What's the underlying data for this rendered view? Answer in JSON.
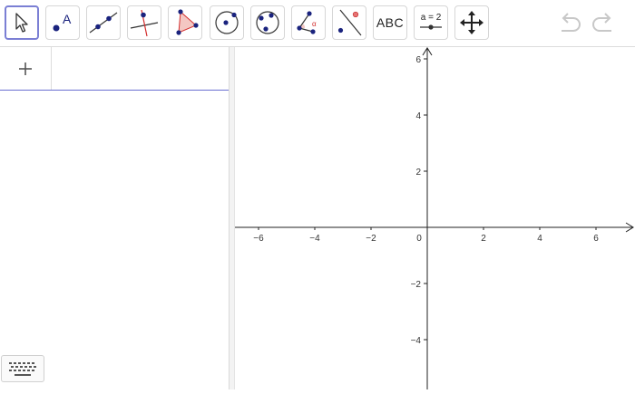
{
  "toolbar": {
    "tools": [
      {
        "name": "move-tool",
        "icon": "cursor-arrow-icon",
        "selected": true
      },
      {
        "name": "point-tool",
        "icon": "point-with-label-a-icon",
        "label": "A"
      },
      {
        "name": "line-tool",
        "icon": "line-through-two-points-icon"
      },
      {
        "name": "perpendicular-line-tool",
        "icon": "perpendicular-line-icon"
      },
      {
        "name": "polygon-tool",
        "icon": "polygon-triangle-icon"
      },
      {
        "name": "circle-tool",
        "icon": "circle-center-point-icon"
      },
      {
        "name": "circle-through-points-tool",
        "icon": "circle-three-points-icon"
      },
      {
        "name": "angle-tool",
        "icon": "angle-icon",
        "label": "α"
      },
      {
        "name": "reflect-tool",
        "icon": "reflect-about-line-icon"
      },
      {
        "name": "text-tool",
        "label": "ABC"
      },
      {
        "name": "slider-tool",
        "icon": "slider-icon",
        "label": "a = 2"
      },
      {
        "name": "move-graphics-view-tool",
        "icon": "move-arrows-icon"
      }
    ],
    "undo_icon": "undo-icon",
    "redo_icon": "redo-icon",
    "colors": {
      "selected_border": "#7b7fd4",
      "point": "#1a237e",
      "polygon_fill": "#f4c7c3",
      "accent_red": "#d32f2f"
    }
  },
  "algebra": {
    "add_icon": "plus-icon",
    "input_value": "",
    "input_underline_color": "#6a6fd1"
  },
  "keyboard_button": {
    "icon": "keyboard-icon"
  },
  "graphics": {
    "x_ticks": [
      "−6",
      "−4",
      "−2",
      "2",
      "4",
      "6"
    ],
    "y_ticks": [
      "6",
      "4",
      "2",
      "−2",
      "−4"
    ],
    "origin_label": "0",
    "x_range": [
      -6.9,
      7.4
    ],
    "y_range": [
      -5.7,
      6.4
    ],
    "grid": false
  }
}
